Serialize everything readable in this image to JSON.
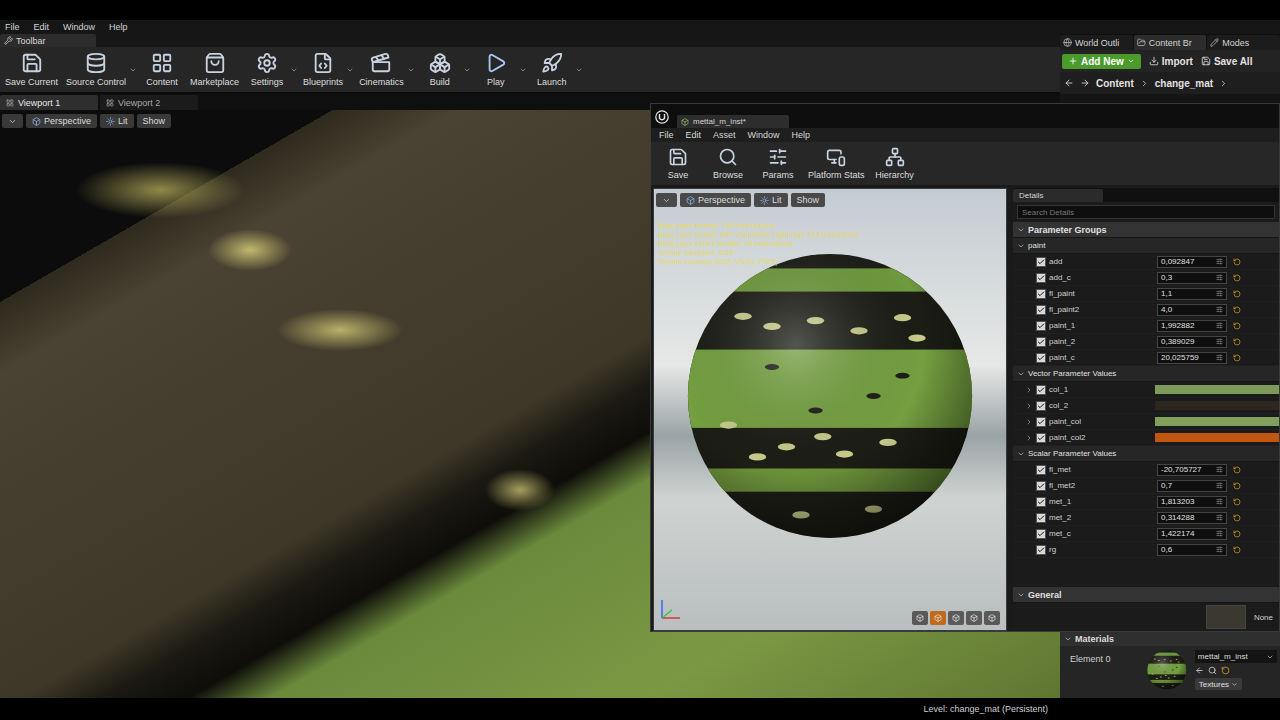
{
  "titlebar": {
    "menu": [
      "File",
      "Edit",
      "Window",
      "Help"
    ]
  },
  "toolbar": {
    "tab": "Toolbar",
    "buttons": [
      {
        "label": "Save Current",
        "dropdown": false
      },
      {
        "label": "Source Control",
        "dropdown": true
      },
      {
        "label": "Content",
        "dropdown": false
      },
      {
        "label": "Marketplace",
        "dropdown": false
      },
      {
        "label": "Settings",
        "dropdown": true
      },
      {
        "label": "Blueprints",
        "dropdown": true
      },
      {
        "label": "Cinematics",
        "dropdown": true
      },
      {
        "label": "Build",
        "dropdown": true
      },
      {
        "label": "Play",
        "dropdown": true
      },
      {
        "label": "Launch",
        "dropdown": true
      }
    ]
  },
  "side_tabs": [
    {
      "label": "World Outli",
      "selected": false
    },
    {
      "label": "Content Br",
      "selected": true
    },
    {
      "label": "Modes",
      "selected": false
    }
  ],
  "content_browser": {
    "add_new": "Add New",
    "import": "Import",
    "save_all": "Save All",
    "path": [
      "Content",
      "change_mat"
    ]
  },
  "viewport_tabs": [
    {
      "label": "Viewport 1",
      "selected": true
    },
    {
      "label": "Viewport 2",
      "selected": false
    }
  ],
  "viewport": {
    "buttons": [
      "Perspective",
      "Lit",
      "Show"
    ],
    "level": "Level: change_mat (Persistent)"
  },
  "material_editor": {
    "tab": "mettal_m_inst*",
    "menu": [
      "File",
      "Edit",
      "Asset",
      "Window",
      "Help"
    ],
    "toolbar": [
      "Save",
      "Browse",
      "Params",
      "Platform Stats",
      "Hierarchy"
    ],
    "preview": {
      "buttons": [
        "Perspective",
        "Lit",
        "Show"
      ],
      "stats": [
        "Base pass shader: 150 instructions",
        "Base pass shader with Volumetric Lightmap: 224 instructions",
        "Base pass vertex shader: 38 instructions",
        "Texture samplers: 6/16",
        "Texture Lookups (Est): VS(0), PS(3)"
      ]
    },
    "details": {
      "tab": "Details",
      "search": {
        "placeholder": "Search Details"
      },
      "title": "Parameter Groups",
      "expanded": true,
      "groups": [
        {
          "name": "paint",
          "expanded": true,
          "params": [
            {
              "name": "add",
              "kind": "scalar",
              "checked": true,
              "value": "0,092847"
            },
            {
              "name": "add_c",
              "kind": "scalar",
              "checked": true,
              "value": "0,3"
            },
            {
              "name": "fl_paint",
              "kind": "scalar",
              "checked": true,
              "value": "1,1"
            },
            {
              "name": "fl_paint2",
              "kind": "scalar",
              "checked": true,
              "value": "4,0"
            },
            {
              "name": "paint_1",
              "kind": "scalar",
              "checked": true,
              "value": "1,992882"
            },
            {
              "name": "paint_2",
              "kind": "scalar",
              "checked": true,
              "value": "0,389029"
            },
            {
              "name": "paint_c",
              "kind": "scalar",
              "checked": true,
              "value": "20,025759"
            }
          ]
        },
        {
          "name": "Vector Parameter Values",
          "expanded": true,
          "params": [
            {
              "name": "col_1",
              "kind": "color",
              "checked": true,
              "color": "#7d9a5a"
            },
            {
              "name": "col_2",
              "kind": "color",
              "checked": true,
              "color": "#2b271f"
            },
            {
              "name": "paint_col",
              "kind": "color",
              "checked": true,
              "color": "#80a05c"
            },
            {
              "name": "paint_col2",
              "kind": "color",
              "checked": true,
              "color": "#c0560f"
            }
          ]
        },
        {
          "name": "Scalar Parameter Values",
          "expanded": true,
          "params": [
            {
              "name": "fl_met",
              "kind": "scalar",
              "checked": true,
              "value": "-20,705727"
            },
            {
              "name": "fl_met2",
              "kind": "scalar",
              "checked": true,
              "value": "0,7"
            },
            {
              "name": "met_1",
              "kind": "scalar",
              "checked": true,
              "value": "1,813203"
            },
            {
              "name": "met_2",
              "kind": "scalar",
              "checked": true,
              "value": "0,314288"
            },
            {
              "name": "met_c",
              "kind": "scalar",
              "checked": true,
              "value": "1,422174"
            },
            {
              "name": "rg",
              "kind": "scalar",
              "checked": true,
              "value": "0,6"
            }
          ]
        }
      ],
      "general": {
        "title": "General",
        "expanded": true,
        "value": "None"
      }
    }
  },
  "materials_panel": {
    "title": "Materials",
    "element": "Element 0",
    "asset": "mettal_m_inst",
    "textures": "Textures"
  }
}
